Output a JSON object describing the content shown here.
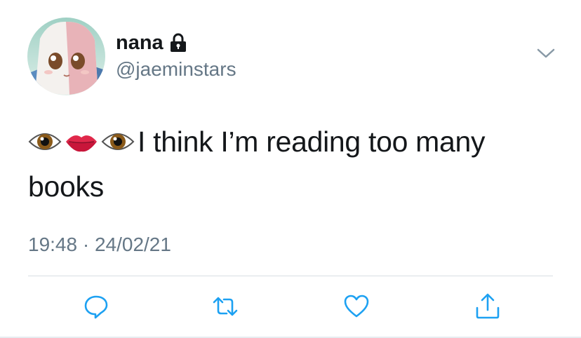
{
  "header": {
    "display_name": "nana",
    "handle": "@jaeminstars",
    "avatar_icon": "anime-character-avatar",
    "lock_icon": "lock-icon",
    "menu_icon": "chevron-down-icon"
  },
  "tweet": {
    "emojis": [
      "eye-emoji",
      "lips-emoji",
      "eye-emoji"
    ],
    "text": "I think I’m reading too many books"
  },
  "meta": {
    "timestamp": "19:48 · 24/02/21"
  },
  "actions": [
    {
      "icon": "reply-icon"
    },
    {
      "icon": "retweet-icon"
    },
    {
      "icon": "like-icon"
    },
    {
      "icon": "share-icon"
    }
  ],
  "colors": {
    "primary_text": "#14171a",
    "secondary_text": "#657786",
    "icon": "#1da1f2",
    "divider": "#d8dee3"
  }
}
